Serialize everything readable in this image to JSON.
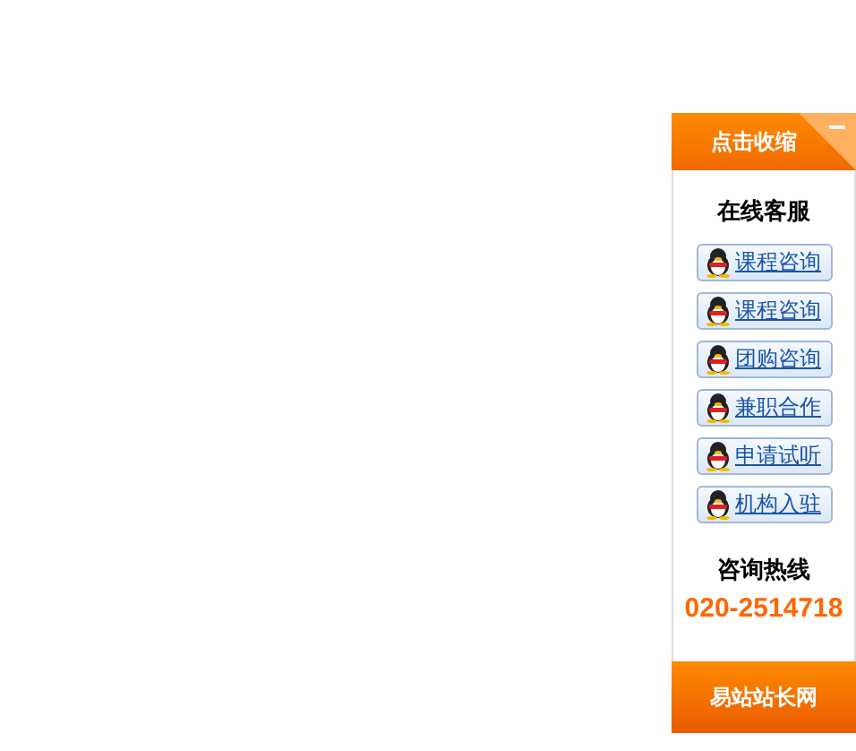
{
  "header": {
    "label": "点击收缩"
  },
  "title": "在线客服",
  "contacts": [
    {
      "label": "课程咨询"
    },
    {
      "label": "课程咨询"
    },
    {
      "label": "团购咨询"
    },
    {
      "label": "兼职合作"
    },
    {
      "label": "申请试听"
    },
    {
      "label": "机构入驻"
    }
  ],
  "hotline": {
    "title": "咨询热线",
    "number": "020-2514718"
  },
  "footer": {
    "label": "易站站长网"
  }
}
